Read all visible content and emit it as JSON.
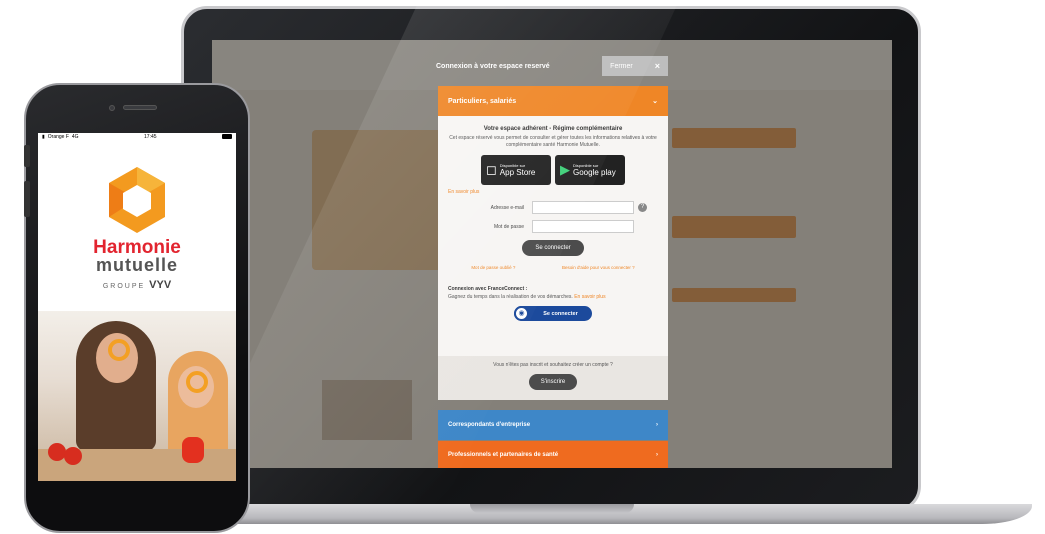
{
  "modal": {
    "title": "Connexion à votre espace reservé",
    "close_label": "Fermer",
    "close_icon": "×"
  },
  "sections": {
    "particuliers": {
      "label": "Particuliers, salariés",
      "icon": "chevron-down"
    },
    "entreprise": {
      "label": "Correspondants d'entreprise",
      "icon": "chevron-right"
    },
    "professionnels": {
      "label": "Professionnels et partenaires de santé",
      "icon": "chevron-right"
    }
  },
  "espace": {
    "title": "Votre espace adhérent - Régime complémentaire",
    "description": "Cet espace réservé vous permet de consulter et gérer toutes les informations relatives à votre complémentaire santé Harmonie Mutuelle.",
    "app_store": {
      "small": "Disponible sur",
      "big": "App Store"
    },
    "google_play": {
      "small": "Disponible sur",
      "big": "Google play"
    },
    "en_savoir_plus": "En savoir plus",
    "email_label": "Adresse e-mail",
    "password_label": "Mot de passe",
    "connect_label": "Se connecter",
    "forgot_password": "Mot de passe oublié ?",
    "help_link": "Besoin d'aide pour vous connecter ?"
  },
  "franceconnect": {
    "title": "Connexion avec FranceConnect :",
    "text": "Gagnez du temps dans la réalisation de vos démarches.",
    "link": "En savoir plus",
    "button_label": "Se connecter"
  },
  "register": {
    "text": "Vous n'êtes pas inscrit et souhaitez créer un compte ?",
    "button_label": "S'inscrire"
  },
  "phone": {
    "carrier": "Orange F",
    "network": "4G",
    "time": "17:45",
    "brand_line1": "Harmonie",
    "brand_line2": "mutuelle",
    "group_prefix": "GROUPE",
    "group_name": "VYV"
  },
  "colors": {
    "orange": "#ef8626",
    "blue": "#3e87c8",
    "brand_red": "#e2242f",
    "franceconnect_blue": "#1c4a9c"
  }
}
